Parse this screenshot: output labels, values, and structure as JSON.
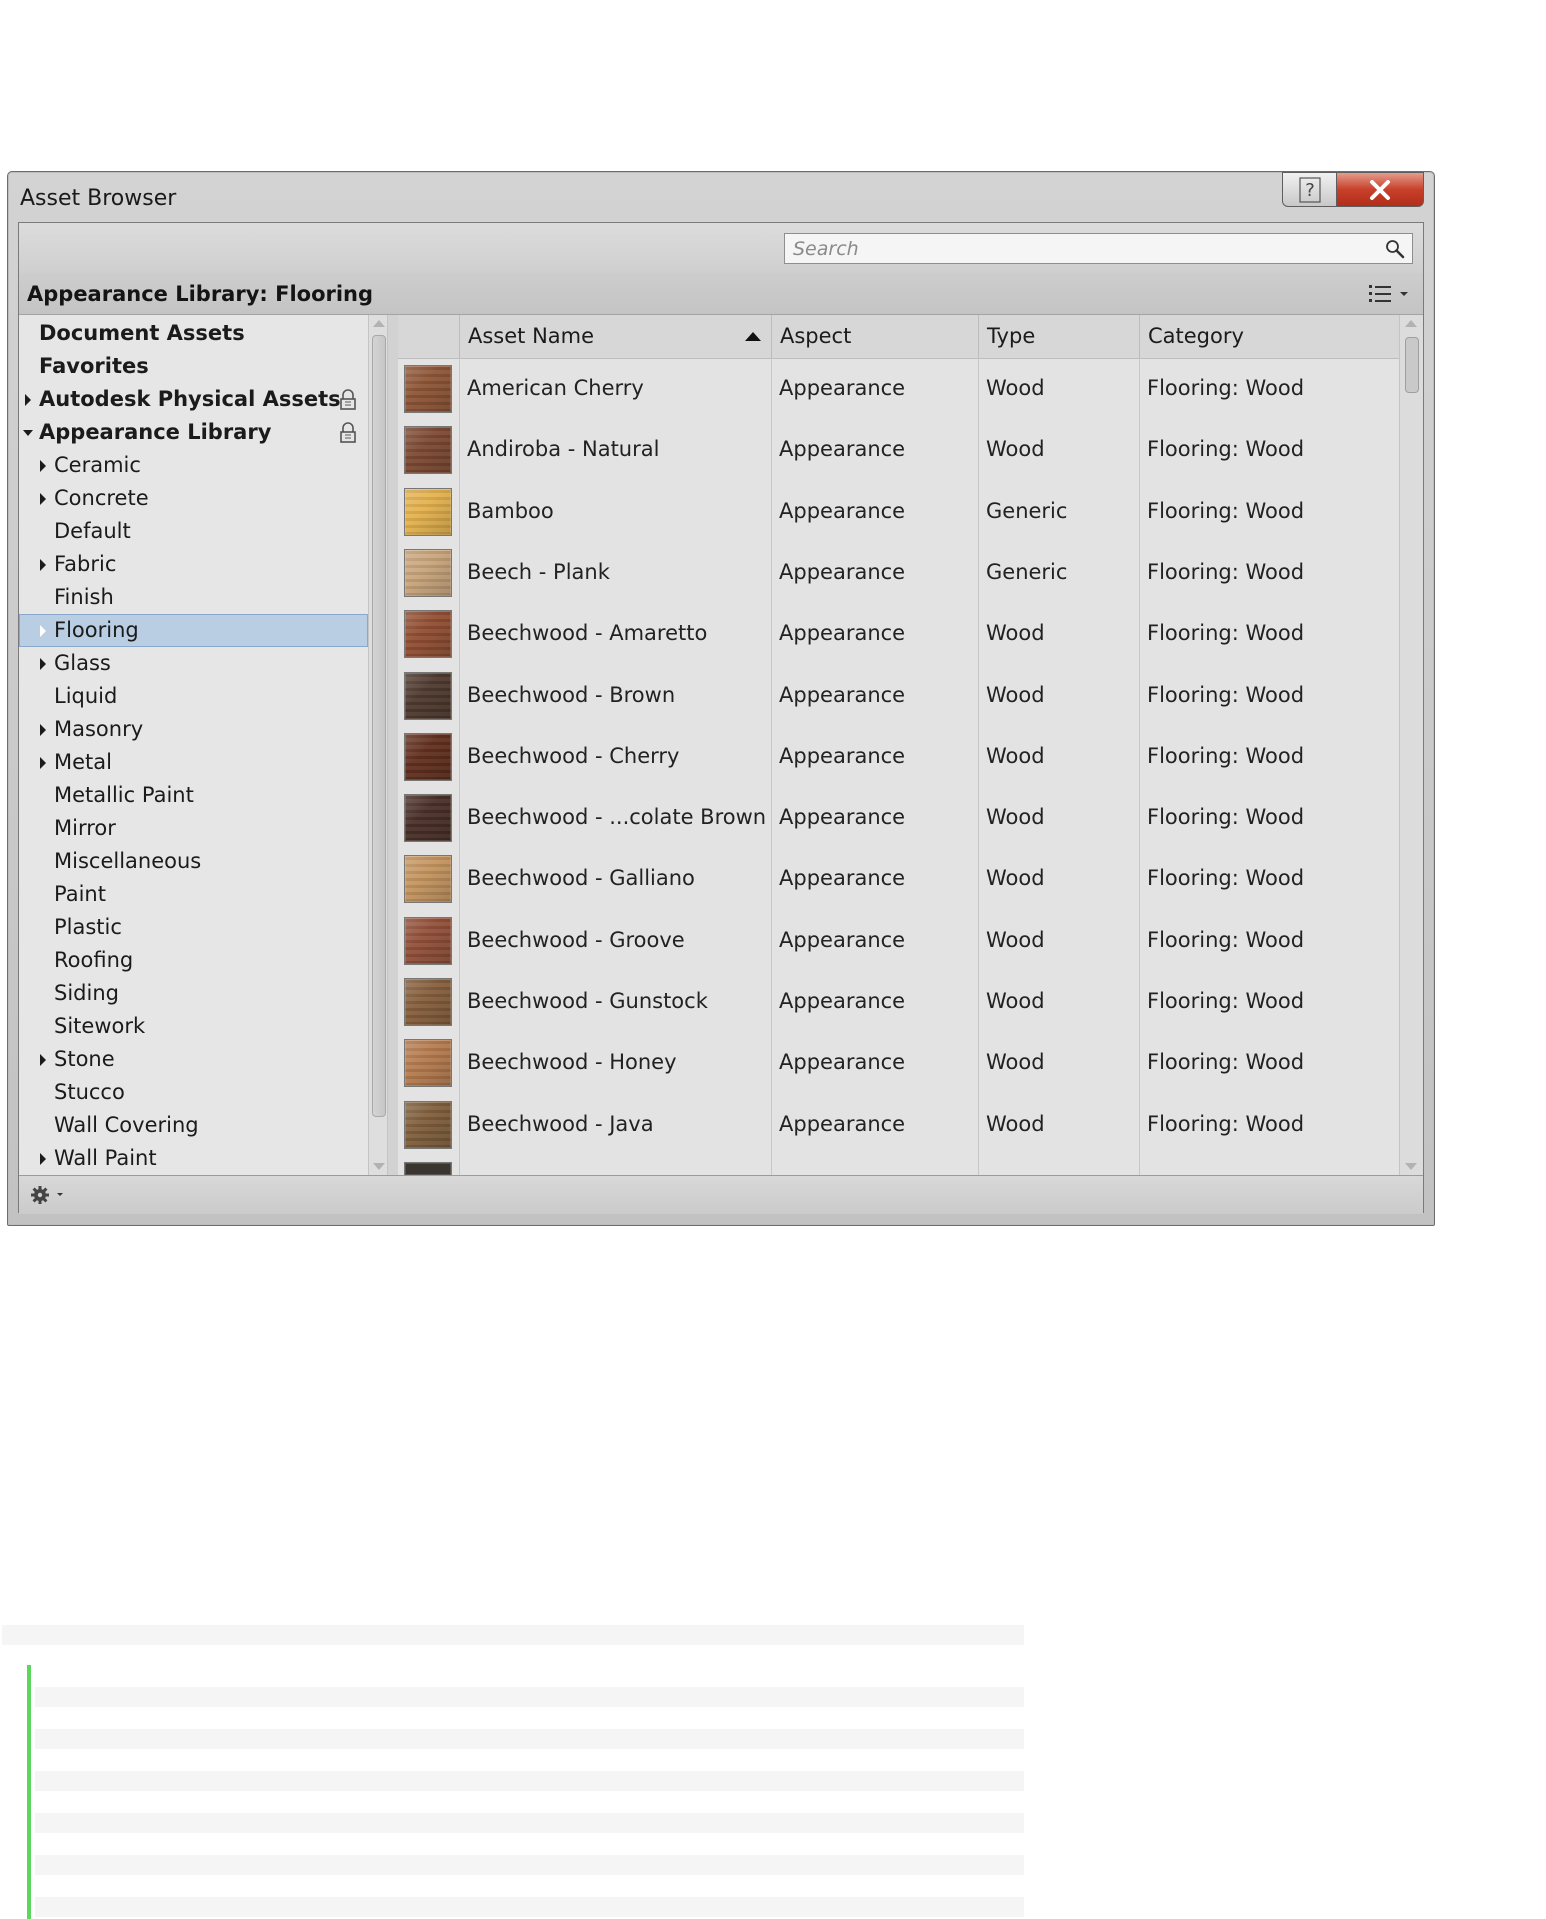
{
  "window": {
    "title": "Asset Browser",
    "help_label": "?",
    "close_label": "X"
  },
  "search": {
    "placeholder": "Search",
    "value": ""
  },
  "library_header": {
    "title": "Appearance Library: Flooring"
  },
  "tree": {
    "items": [
      {
        "label": "Document Assets",
        "bold": true,
        "level": 0,
        "arrow": "none",
        "lock": false,
        "selected": false
      },
      {
        "label": "Favorites",
        "bold": true,
        "level": 0,
        "arrow": "none",
        "lock": false,
        "selected": false
      },
      {
        "label": "Autodesk Physical Assets",
        "bold": true,
        "level": 0,
        "arrow": "collapsed",
        "lock": true,
        "selected": false
      },
      {
        "label": "Appearance Library",
        "bold": true,
        "level": 0,
        "arrow": "expanded",
        "lock": true,
        "selected": false
      },
      {
        "label": "Ceramic",
        "bold": false,
        "level": 1,
        "arrow": "collapsed",
        "lock": false,
        "selected": false
      },
      {
        "label": "Concrete",
        "bold": false,
        "level": 1,
        "arrow": "collapsed",
        "lock": false,
        "selected": false
      },
      {
        "label": "Default",
        "bold": false,
        "level": 1,
        "arrow": "none",
        "lock": false,
        "selected": false
      },
      {
        "label": "Fabric",
        "bold": false,
        "level": 1,
        "arrow": "collapsed",
        "lock": false,
        "selected": false
      },
      {
        "label": "Finish",
        "bold": false,
        "level": 1,
        "arrow": "none",
        "lock": false,
        "selected": false
      },
      {
        "label": "Flooring",
        "bold": false,
        "level": 1,
        "arrow": "collapsed-white",
        "lock": false,
        "selected": true
      },
      {
        "label": "Glass",
        "bold": false,
        "level": 1,
        "arrow": "collapsed",
        "lock": false,
        "selected": false
      },
      {
        "label": "Liquid",
        "bold": false,
        "level": 1,
        "arrow": "none",
        "lock": false,
        "selected": false
      },
      {
        "label": "Masonry",
        "bold": false,
        "level": 1,
        "arrow": "collapsed",
        "lock": false,
        "selected": false
      },
      {
        "label": "Metal",
        "bold": false,
        "level": 1,
        "arrow": "collapsed",
        "lock": false,
        "selected": false
      },
      {
        "label": "Metallic Paint",
        "bold": false,
        "level": 1,
        "arrow": "none",
        "lock": false,
        "selected": false
      },
      {
        "label": "Mirror",
        "bold": false,
        "level": 1,
        "arrow": "none",
        "lock": false,
        "selected": false
      },
      {
        "label": "Miscellaneous",
        "bold": false,
        "level": 1,
        "arrow": "none",
        "lock": false,
        "selected": false
      },
      {
        "label": "Paint",
        "bold": false,
        "level": 1,
        "arrow": "none",
        "lock": false,
        "selected": false
      },
      {
        "label": "Plastic",
        "bold": false,
        "level": 1,
        "arrow": "none",
        "lock": false,
        "selected": false
      },
      {
        "label": "Roofing",
        "bold": false,
        "level": 1,
        "arrow": "none",
        "lock": false,
        "selected": false
      },
      {
        "label": "Siding",
        "bold": false,
        "level": 1,
        "arrow": "none",
        "lock": false,
        "selected": false
      },
      {
        "label": "Sitework",
        "bold": false,
        "level": 1,
        "arrow": "none",
        "lock": false,
        "selected": false
      },
      {
        "label": "Stone",
        "bold": false,
        "level": 1,
        "arrow": "collapsed",
        "lock": false,
        "selected": false
      },
      {
        "label": "Stucco",
        "bold": false,
        "level": 1,
        "arrow": "none",
        "lock": false,
        "selected": false
      },
      {
        "label": "Wall Covering",
        "bold": false,
        "level": 1,
        "arrow": "none",
        "lock": false,
        "selected": false
      },
      {
        "label": "Wall Paint",
        "bold": false,
        "level": 1,
        "arrow": "collapsed",
        "lock": false,
        "selected": false
      }
    ]
  },
  "table": {
    "columns": [
      "Asset Name",
      "Aspect",
      "Type",
      "Category"
    ],
    "sort_column": "Asset Name",
    "sort_direction": "ascending",
    "rows": [
      {
        "name": "American Cherry",
        "aspect": "Appearance",
        "type": "Wood",
        "category": "Flooring: Wood",
        "swatch": "#8f5637"
      },
      {
        "name": "Andiroba - Natural",
        "aspect": "Appearance",
        "type": "Wood",
        "category": "Flooring: Wood",
        "swatch": "#7e4a33"
      },
      {
        "name": "Bamboo",
        "aspect": "Appearance",
        "type": "Generic",
        "category": "Flooring: Wood",
        "swatch": "#e5b24e"
      },
      {
        "name": "Beech - Plank",
        "aspect": "Appearance",
        "type": "Generic",
        "category": "Flooring: Wood",
        "swatch": "#c9a57c"
      },
      {
        "name": "Beechwood - Amaretto",
        "aspect": "Appearance",
        "type": "Wood",
        "category": "Flooring: Wood",
        "swatch": "#924f33"
      },
      {
        "name": "Beechwood - Brown",
        "aspect": "Appearance",
        "type": "Wood",
        "category": "Flooring: Wood",
        "swatch": "#4f3a2f"
      },
      {
        "name": "Beechwood - Cherry",
        "aspect": "Appearance",
        "type": "Wood",
        "category": "Flooring: Wood",
        "swatch": "#62301f"
      },
      {
        "name": "Beechwood - ...colate Brown",
        "aspect": "Appearance",
        "type": "Wood",
        "category": "Flooring: Wood",
        "swatch": "#4a3028"
      },
      {
        "name": "Beechwood - Galliano",
        "aspect": "Appearance",
        "type": "Wood",
        "category": "Flooring: Wood",
        "swatch": "#c59660"
      },
      {
        "name": "Beechwood - Groove",
        "aspect": "Appearance",
        "type": "Wood",
        "category": "Flooring: Wood",
        "swatch": "#93503a"
      },
      {
        "name": "Beechwood - Gunstock",
        "aspect": "Appearance",
        "type": "Wood",
        "category": "Flooring: Wood",
        "swatch": "#875f3d"
      },
      {
        "name": "Beechwood - Honey",
        "aspect": "Appearance",
        "type": "Wood",
        "category": "Flooring: Wood",
        "swatch": "#b67c4f"
      },
      {
        "name": "Beechwood - Java",
        "aspect": "Appearance",
        "type": "Wood",
        "category": "Flooring: Wood",
        "swatch": "#81603d"
      }
    ]
  },
  "colors": {
    "selection": "#b9cde3",
    "close_button": "#c8402a",
    "panel": "#e6e6e6"
  }
}
